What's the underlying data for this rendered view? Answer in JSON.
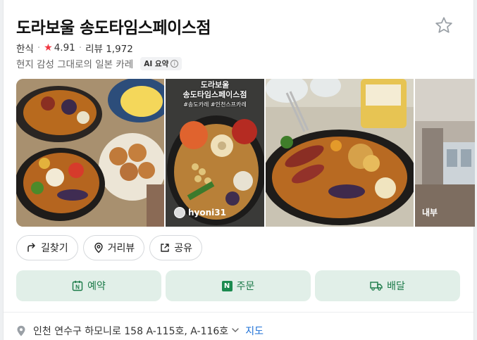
{
  "place": {
    "name": "도라보울 송도타임스페이스점",
    "category": "한식",
    "rating": "4.91",
    "reviews_label": "리뷰 1,972",
    "summary": "현지 감성 그대로의 일본 카레",
    "ai_badge": "AI 요약"
  },
  "photos": {
    "user_handle": "hyoni31",
    "inner_label": "내부",
    "caption_line1": "도라보울",
    "caption_line2": "송도타임스페이스점",
    "caption_small": "#송도카레 #인천스프카레"
  },
  "actions": {
    "directions": "길찾기",
    "street_view": "거리뷰",
    "share": "공유"
  },
  "buttons": {
    "reserve": "예약",
    "order": "주문",
    "delivery": "배달"
  },
  "address": {
    "text": "인천 연수구 하모니로 158 A-115호, A-116호",
    "map_link": "지도"
  },
  "colors": {
    "rating_star": "#f0353f",
    "button_bg": "#e1efe8",
    "button_text": "#1b7a48",
    "link": "#1b6fd6"
  }
}
